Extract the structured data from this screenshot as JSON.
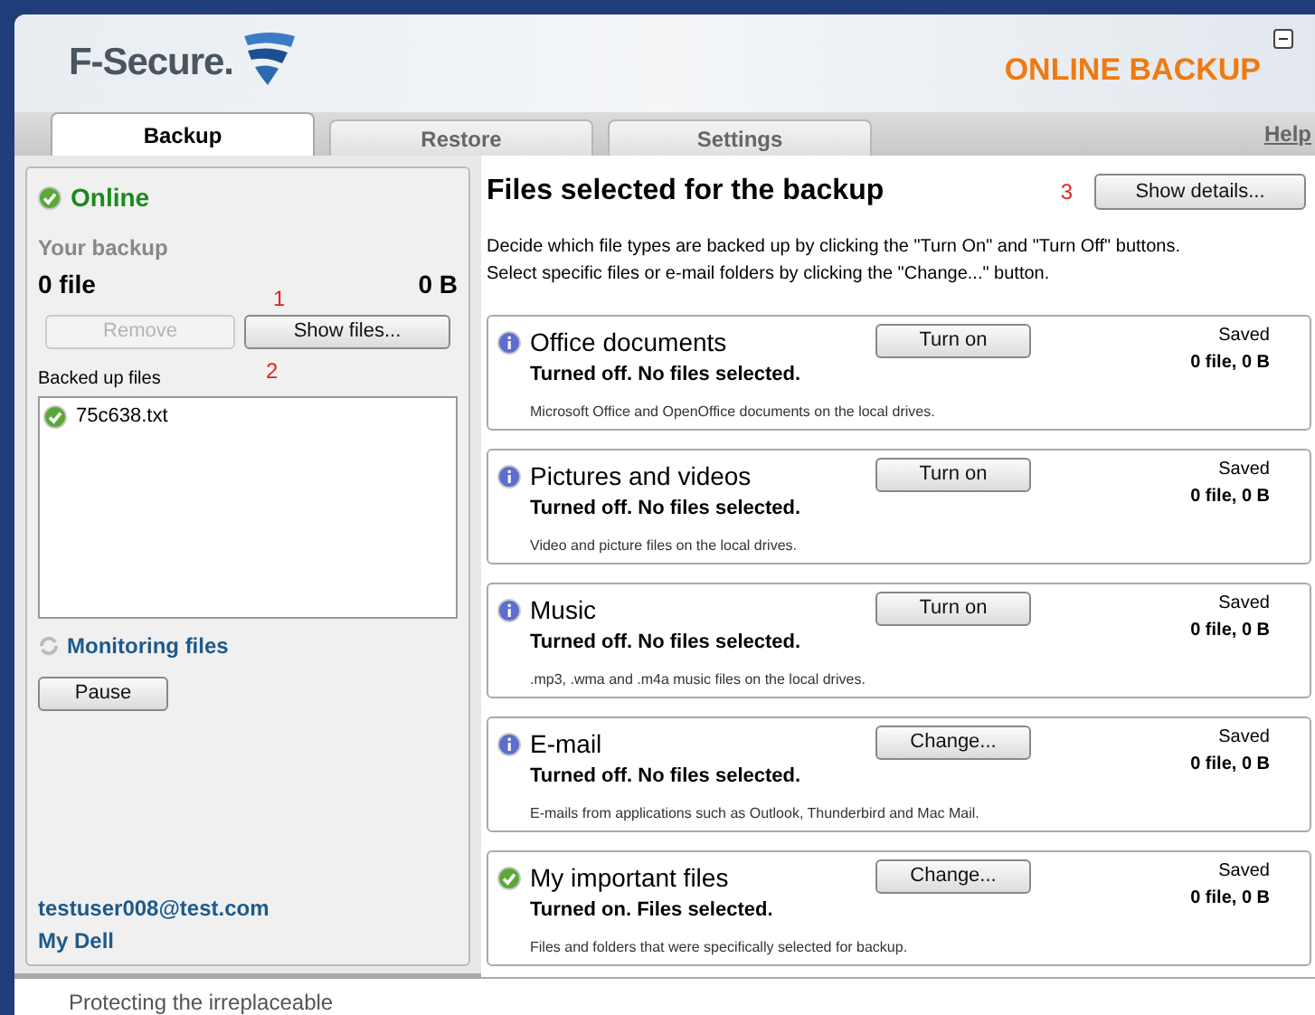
{
  "header": {
    "brand": "F-Secure.",
    "product": "ONLINE BACKUP"
  },
  "tabs": [
    {
      "label": "Backup",
      "selected": true
    },
    {
      "label": "Restore",
      "selected": false
    },
    {
      "label": "Settings",
      "selected": false
    }
  ],
  "help_link": "Help",
  "status": {
    "label": "Online",
    "online": true
  },
  "your_backup": {
    "label": "Your backup",
    "files": "0 file",
    "size": "0 B"
  },
  "buttons": [
    {
      "label": "Remove",
      "disabled": true
    },
    {
      "label": "Show files...",
      "disabled": false
    }
  ],
  "backed_up": {
    "label": "Backed up files",
    "files": [
      "75c638.txt"
    ]
  },
  "monitoring": {
    "label": "Monitoring files",
    "button": "Pause"
  },
  "account": {
    "email": "testuser008@test.com",
    "link": "My Dell"
  },
  "annotations": [
    "1",
    "2",
    "3"
  ],
  "content": {
    "title": "Files selected for the backup",
    "details_button": "Show details...",
    "intro": "Decide which file types are backed up by clicking the \"Turn On\" and \"Turn Off\" buttons.\nSelect specific files or e-mail folders by clicking the \"Change...\" button."
  },
  "categories": [
    {
      "name": "Office documents",
      "on": false,
      "status": "Turned off. No files selected.",
      "description": "Microsoft Office and OpenOffice documents on the local drives.",
      "button": "Turn on",
      "saved_label": "Saved",
      "saved": "0 file, 0 B"
    },
    {
      "name": "Pictures and videos",
      "on": false,
      "status": "Turned off. No files selected.",
      "description": "Video and picture files on the local drives.",
      "button": "Turn on",
      "saved_label": "Saved",
      "saved": "0 file, 0 B"
    },
    {
      "name": "Music",
      "on": false,
      "status": "Turned off. No files selected.",
      "description": ".mp3, .wma and .m4a music files on the local drives.",
      "button": "Turn on",
      "saved_label": "Saved",
      "saved": "0 file, 0 B"
    },
    {
      "name": "E-mail",
      "on": false,
      "status": "Turned off. No files selected.",
      "description": "E-mails from applications such as Outlook, Thunderbird and Mac Mail.",
      "button": "Change...",
      "saved_label": "Saved",
      "saved": "0 file, 0 B"
    },
    {
      "name": "My important files",
      "on": true,
      "status": "Turned on. Files selected.",
      "description": "Files and folders that were specifically selected for backup.",
      "button": "Change...",
      "saved_label": "Saved",
      "saved": "0 file, 0 B"
    }
  ],
  "footer": "Protecting the irreplaceable"
}
